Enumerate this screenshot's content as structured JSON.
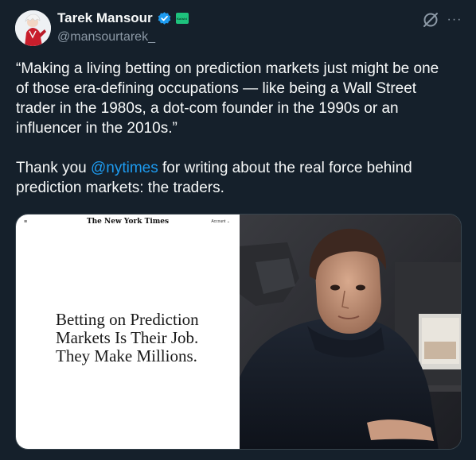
{
  "author": {
    "display_name": "Tarek Mansour",
    "handle": "@mansourtarek_",
    "affiliation_badge": "Kalshi",
    "verified_color": "#1d9bf0",
    "affiliation_color": "#1ec27d"
  },
  "header_icons": {
    "grok": "grok-icon",
    "more": "more-icon",
    "more_glyph": "···"
  },
  "tweet": {
    "quote_lines": [
      "“Making a living betting on prediction markets just might be one",
      "of those era-defining occupations — like being a Wall Street",
      "trader in the 1980s, a dot-com founder in the 1990s or an",
      "influencer in the 2010s.”"
    ],
    "thanks_prefix": "Thank you ",
    "mention": "@nytimes",
    "thanks_suffix": " for writing about the real force behind",
    "thanks_line2": "prediction markets: the traders."
  },
  "media": {
    "nyt_menu": "≡",
    "nyt_logo": "The New York Times",
    "nyt_account": "Account ⌄",
    "headline_lines": [
      "Betting on Prediction",
      "Markets Is Their Job.",
      "They Make Millions."
    ]
  }
}
